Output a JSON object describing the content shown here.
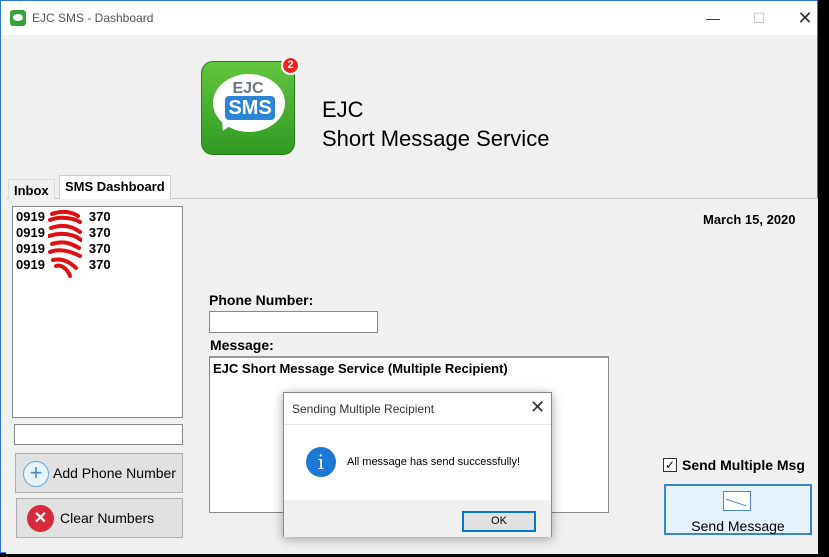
{
  "window": {
    "title": "EJC SMS - Dashboard"
  },
  "header": {
    "logo_text": "EJC",
    "logo_sms": "SMS",
    "badge": "2",
    "title_line1": "EJC",
    "title_line2": "Short Message Service"
  },
  "tabs": [
    {
      "label": "Inbox"
    },
    {
      "label": "SMS Dashboard"
    }
  ],
  "phone_list": {
    "items": [
      {
        "prefix": "0919",
        "suffix": "370"
      },
      {
        "prefix": "0919",
        "suffix": "370"
      },
      {
        "prefix": "0919",
        "suffix": "370"
      },
      {
        "prefix": "0919",
        "suffix": "370"
      }
    ]
  },
  "buttons": {
    "add": "Add Phone Number",
    "clear": "Clear Numbers",
    "send": "Send Message"
  },
  "date": "March 15, 2020",
  "form": {
    "phone_label": "Phone Number:",
    "phone_value": "",
    "message_label": "Message:",
    "message_value": "EJC Short Message Service (Multiple Recipient)"
  },
  "send_multiple": {
    "label": "Send Multiple Msg",
    "checked": true
  },
  "dialog": {
    "title": "Sending Multiple Recipient",
    "message": "All message has send successfully!",
    "ok": "OK"
  },
  "colors": {
    "accent": "#0078d7",
    "logo_green": "#3aa23a",
    "logo_blue": "#2a85d6",
    "badge_red": "#e22222"
  }
}
